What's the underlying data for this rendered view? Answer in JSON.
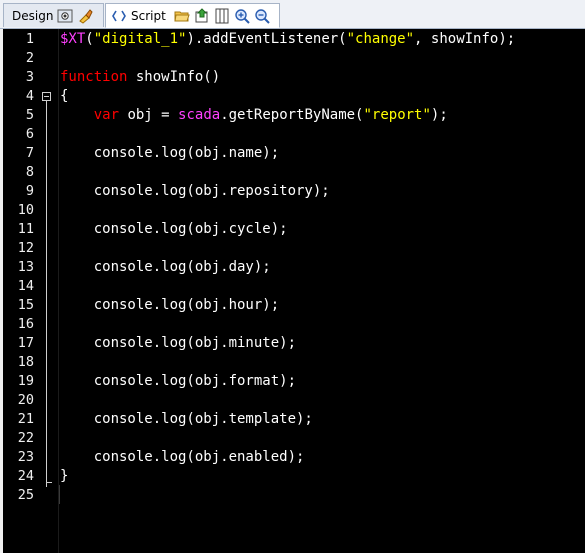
{
  "tabs": {
    "design_label": "Design",
    "script_label": "Script"
  },
  "icons": {
    "design": [
      "preview-icon",
      "brush-icon"
    ],
    "script": [
      "open-folder-icon",
      "save-icon",
      "columns-icon",
      "zoom-in-icon",
      "zoom-out-icon"
    ]
  },
  "editor": {
    "line_numbers": [
      "1",
      "2",
      "3",
      "4",
      "5",
      "6",
      "7",
      "8",
      "9",
      "10",
      "11",
      "12",
      "13",
      "14",
      "15",
      "16",
      "17",
      "18",
      "19",
      "20",
      "21",
      "22",
      "23",
      "24",
      "25"
    ],
    "lines": [
      [
        {
          "t": "$XT",
          "c": "obj"
        },
        {
          "t": "(",
          "c": ""
        },
        {
          "t": "\"digital_1\"",
          "c": "str"
        },
        {
          "t": ").addEventListener(",
          "c": ""
        },
        {
          "t": "\"change\"",
          "c": "str"
        },
        {
          "t": ", showInfo);",
          "c": ""
        }
      ],
      [],
      [
        {
          "t": "function",
          "c": "kw"
        },
        {
          "t": " showInfo()",
          "c": ""
        }
      ],
      [
        {
          "t": "{",
          "c": ""
        }
      ],
      [
        {
          "t": "    ",
          "c": ""
        },
        {
          "t": "var",
          "c": "kw"
        },
        {
          "t": " obj = ",
          "c": ""
        },
        {
          "t": "scada",
          "c": "obj"
        },
        {
          "t": ".getReportByName(",
          "c": ""
        },
        {
          "t": "\"report\"",
          "c": "str"
        },
        {
          "t": ");",
          "c": ""
        }
      ],
      [],
      [
        {
          "t": "    console.log(obj.name);",
          "c": ""
        }
      ],
      [],
      [
        {
          "t": "    console.log(obj.repository);",
          "c": ""
        }
      ],
      [],
      [
        {
          "t": "    console.log(obj.cycle);",
          "c": ""
        }
      ],
      [],
      [
        {
          "t": "    console.log(obj.day);",
          "c": ""
        }
      ],
      [],
      [
        {
          "t": "    console.log(obj.hour);",
          "c": ""
        }
      ],
      [],
      [
        {
          "t": "    console.log(obj.minute);",
          "c": ""
        }
      ],
      [],
      [
        {
          "t": "    console.log(obj.format);",
          "c": ""
        }
      ],
      [],
      [
        {
          "t": "    console.log(obj.template);",
          "c": ""
        }
      ],
      [],
      [
        {
          "t": "    console.log(obj.enabled);",
          "c": ""
        }
      ],
      [
        {
          "t": "}",
          "c": ""
        }
      ],
      []
    ],
    "current_line": 25,
    "colors": {
      "background": "#000000",
      "text": "#ffffff",
      "keyword": "#ff0000",
      "string": "#ffff00",
      "object": "#ff40ff",
      "current_line": "#3a3a3a"
    }
  }
}
